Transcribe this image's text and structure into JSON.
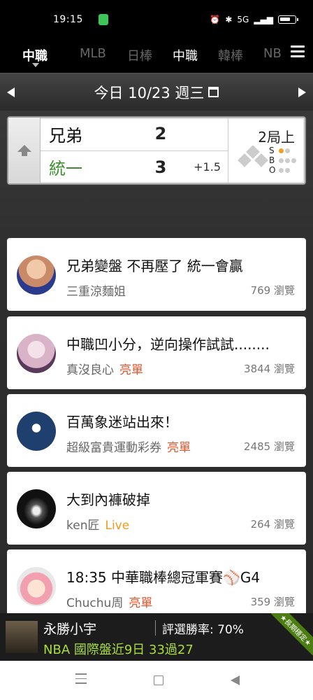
{
  "status": {
    "time": "19:15",
    "network": "5G"
  },
  "league_tabs": [
    {
      "label": "中職",
      "state": "active"
    },
    {
      "label": "MLB",
      "state": "inactive"
    },
    {
      "label": "日棒",
      "state": "inactive"
    },
    {
      "label": "中職",
      "state": "white"
    },
    {
      "label": "韓棒",
      "state": "inactive"
    },
    {
      "label": "NB",
      "state": "inactive"
    }
  ],
  "date_bar": {
    "label": "今日 10/23 週三"
  },
  "game": {
    "away": {
      "name": "兄弟",
      "score": "2",
      "color": "#111111"
    },
    "home": {
      "name": "統一",
      "score": "3",
      "line": "+1.5",
      "color": "#3a8f2e"
    },
    "inning": "2局上",
    "sbo": {
      "s": "S",
      "b": "B",
      "o": "O",
      "strikes": 1,
      "balls": 0,
      "outs": 0
    }
  },
  "posts": [
    {
      "title": "兄弟變盤 不再壓了 統一會贏",
      "author": "三重涼麵姐",
      "tag": "",
      "tag_type": "",
      "views": "769 瀏覽",
      "avatar_color": "#c98a6a"
    },
    {
      "title": "中職凹小分，逆向操作試試........",
      "author": "真沒良心",
      "tag": "亮單",
      "tag_type": "red",
      "views": "3844 瀏覽",
      "avatar_color": "#d9b4c8"
    },
    {
      "title": "百萬象迷站出來！",
      "author": "超級富貴運動彩券",
      "tag": "亮單",
      "tag_type": "red",
      "views": "2485 瀏覽",
      "avatar_color": "#1f3f6e"
    },
    {
      "title": "大到內褲破掉",
      "author": "ken匠",
      "tag": "Live",
      "tag_type": "orange",
      "views": "264 瀏覽",
      "avatar_color": "#111111"
    },
    {
      "title": "18:35 中華職棒總冠軍賽⚾G4",
      "author": "Chuchu周",
      "tag": "亮單",
      "tag_type": "red",
      "views": "359 瀏覽",
      "avatar_color": "#f2b8a8"
    }
  ],
  "banner": {
    "name": "永勝小宇",
    "rate": "評選勝率: 70%",
    "record": "NBA 國際盤近9日 33過27",
    "ribbon": "★長期穩定★"
  }
}
